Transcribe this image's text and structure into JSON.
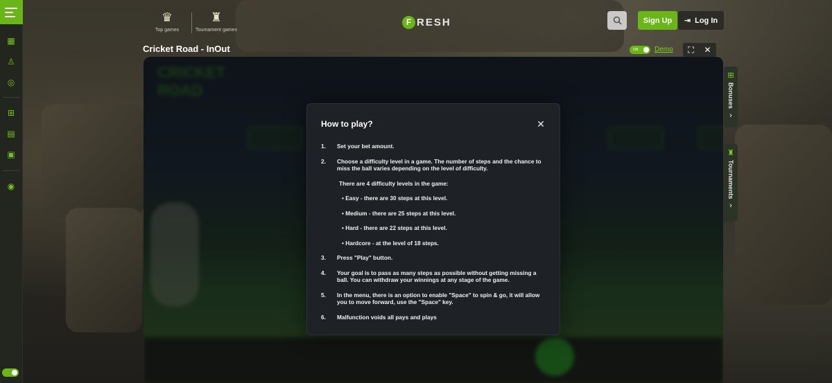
{
  "top_nav": {
    "top_games": "Top games",
    "tournament_games": "Tournament games"
  },
  "brand": {
    "logo_letter": "F",
    "logo_text": "RESH"
  },
  "header": {
    "signup": "Sign Up",
    "login": "Log In"
  },
  "game": {
    "title": "Cricket Road - InOut",
    "demo_toggle": "ON",
    "demo_label": "Demo",
    "logo_text": "CRICKET ROAD"
  },
  "side_tabs": {
    "bonuses": "Bonuses",
    "tournaments": "Tournaments"
  },
  "modal": {
    "title": "How to play?",
    "steps": [
      {
        "num": "1.",
        "text": "Set your bet amount."
      },
      {
        "num": "2.",
        "text": "Choose a difficulty level in a game. The number of steps and the chance to miss the ball varies depending on the level of difficulty."
      },
      {
        "num": "3.",
        "text": "Press \"Play\" button."
      },
      {
        "num": "4.",
        "text": "Your goal is to pass as many steps as possible without getting missing a ball. You can withdraw your winnings at any stage of the game."
      },
      {
        "num": "5.",
        "text": "In the menu, there is an option to enable \"Space\" to spin & go, it will allow you to move forward, use the \"Space\" key."
      },
      {
        "num": "6.",
        "text": "Malfunction voids all pays and plays"
      }
    ],
    "levels_intro": "There are 4 difficulty levels in the game:",
    "levels": [
      "• Easy - there are 30 steps at this level.",
      "• Medium - there are 25 steps at this level.",
      "• Hard - there are 22 steps at this level.",
      "• Hardcore - at the level of 18 steps."
    ]
  },
  "colors": {
    "accent": "#6ab517",
    "modal_bg": "#1e2126"
  }
}
